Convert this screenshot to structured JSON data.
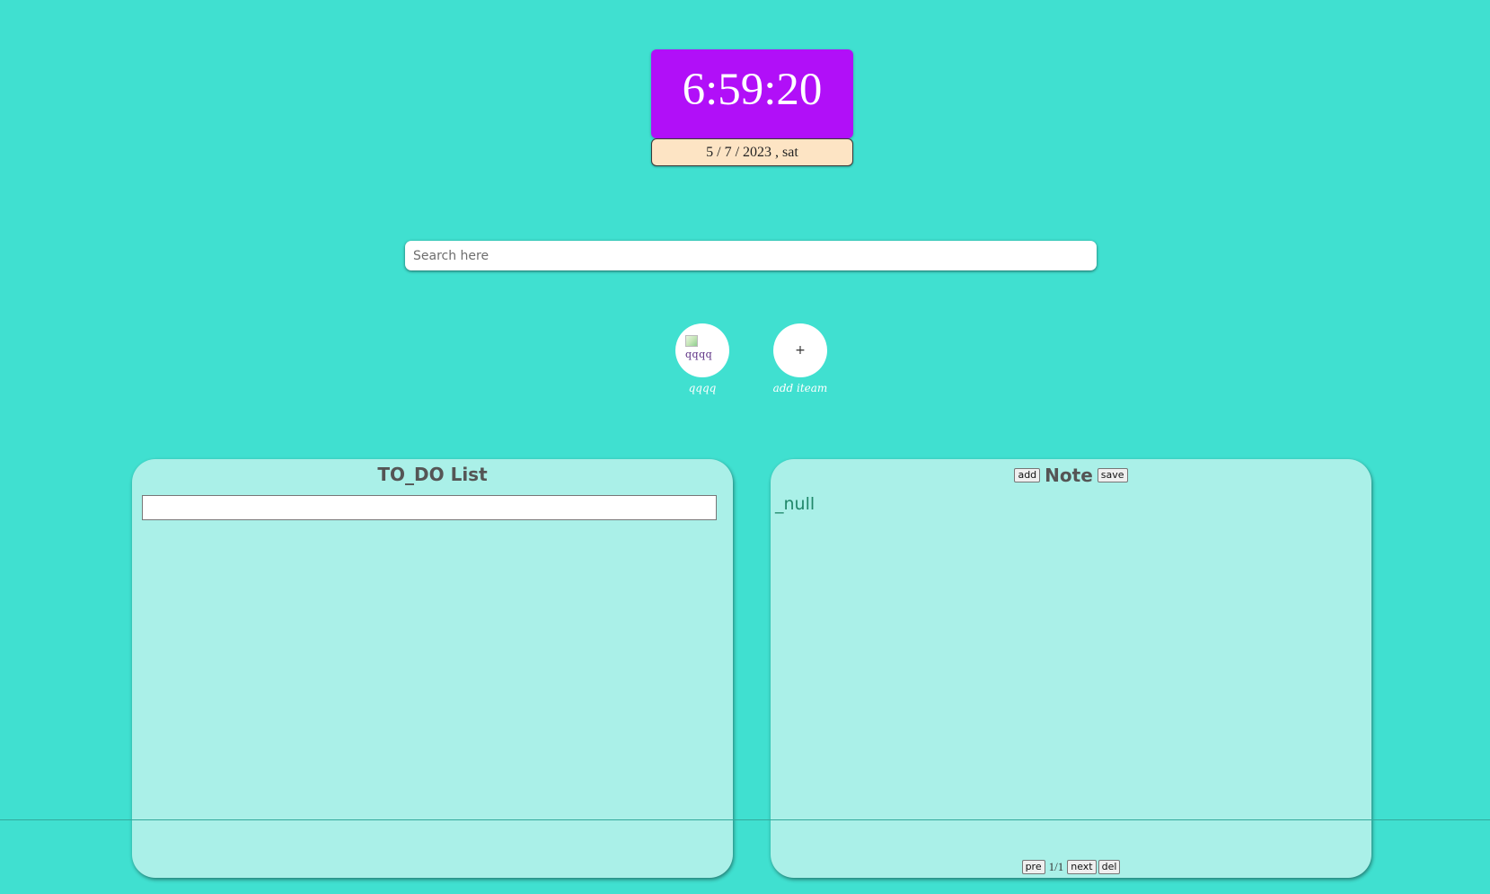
{
  "clock": {
    "time": "6:59:20",
    "date": "5 / 7 / 2023 , sat"
  },
  "search": {
    "placeholder": "Search here",
    "value": ""
  },
  "shortcuts": [
    {
      "label": "qqqq",
      "image_alt": "qqqq"
    },
    {
      "label": "add iteam",
      "icon": "+"
    }
  ],
  "todo": {
    "title": "TO_DO List",
    "input_value": ""
  },
  "note": {
    "title": "Note",
    "add_label": "add",
    "save_label": "save",
    "content": "_null",
    "pager": {
      "pre_label": "pre",
      "page": "1/1",
      "next_label": "next",
      "del_label": "del"
    }
  },
  "colors": {
    "background": "#40e0d0",
    "clock_bg": "#b10ff8",
    "date_bg": "#fde4c4",
    "panel_bg": "#aaf0e8",
    "note_text": "#20876a"
  }
}
